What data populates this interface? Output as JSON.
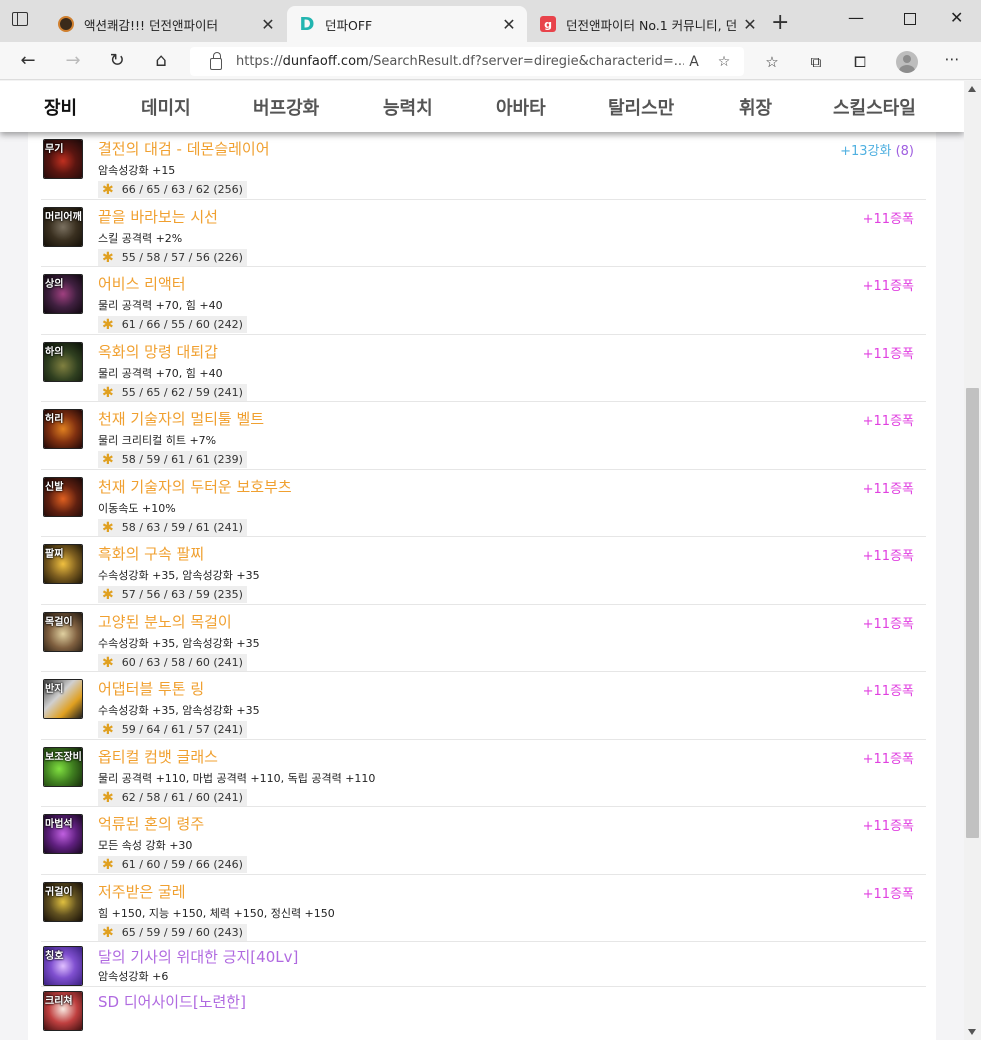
{
  "browser": {
    "tabs": [
      {
        "title": "액션쾌감!!! 던전앤파이터",
        "favicon_color": "#3a2a1a"
      },
      {
        "title": "던파OFF",
        "favicon_color": "#22b5b0"
      },
      {
        "title": "던전앤파이터 No.1 커뮤니티, 던",
        "favicon_color": "#e8434b"
      }
    ],
    "url": "https://dunfaoff.com/SearchResult.df?server=diregie&characterid=...",
    "url_host": "dunfaoff.com",
    "url_prefix": "https://",
    "url_rest": "/SearchResult.df?server=diregie&characterid=..."
  },
  "menu": {
    "items": [
      "장비",
      "데미지",
      "버프강화",
      "능력치",
      "아바타",
      "탈리스만",
      "휘장",
      "스킬스타일"
    ],
    "active": "장비"
  },
  "equipment": [
    {
      "slot": "무기",
      "name": "결전의 대검 - 데몬슬레이어",
      "stat": "암속성강화 +15",
      "badge": "66 / 65 / 63 / 62 (256)",
      "enhance": "+13강화",
      "enhance_extra": "(8)",
      "enhance_type": "reinforce"
    },
    {
      "slot": "머리어깨",
      "name": "끝을 바라보는 시선",
      "stat": "스킬 공격력 +2%",
      "badge": "55 / 58 / 57 / 56 (226)",
      "enhance": "+11증폭",
      "enhance_type": "amplify"
    },
    {
      "slot": "상의",
      "name": "어비스 리액터",
      "stat": "물리 공격력 +70, 힘 +40",
      "badge": "61 / 66 / 55 / 60 (242)",
      "enhance": "+11증폭",
      "enhance_type": "amplify"
    },
    {
      "slot": "하의",
      "name": "옥화의 망령 대퇴갑",
      "stat": "물리 공격력 +70, 힘 +40",
      "badge": "55 / 65 / 62 / 59 (241)",
      "enhance": "+11증폭",
      "enhance_type": "amplify"
    },
    {
      "slot": "허리",
      "name": "천재 기술자의 멀티툴 벨트",
      "stat": "물리 크리티컬 히트 +7%",
      "badge": "58 / 59 / 61 / 61 (239)",
      "enhance": "+11증폭",
      "enhance_type": "amplify"
    },
    {
      "slot": "신발",
      "name": "천재 기술자의 두터운 보호부츠",
      "stat": "이동속도 +10%",
      "badge": "58 / 63 / 59 / 61 (241)",
      "enhance": "+11증폭",
      "enhance_type": "amplify"
    },
    {
      "slot": "팔찌",
      "name": "흑화의 구속 팔찌",
      "stat": "수속성강화 +35, 암속성강화 +35",
      "badge": "57 / 56 / 63 / 59 (235)",
      "enhance": "+11증폭",
      "enhance_type": "amplify"
    },
    {
      "slot": "목걸이",
      "name": "고양된 분노의 목걸이",
      "stat": "수속성강화 +35, 암속성강화 +35",
      "badge": "60 / 63 / 58 / 60 (241)",
      "enhance": "+11증폭",
      "enhance_type": "amplify"
    },
    {
      "slot": "반지",
      "name": "어댑터블 투톤 링",
      "stat": "수속성강화 +35, 암속성강화 +35",
      "badge": "59 / 64 / 61 / 57 (241)",
      "enhance": "+11증폭",
      "enhance_type": "amplify"
    },
    {
      "slot": "보조장비",
      "name": "옵티컬 컴뱃 글래스",
      "stat": "물리 공격력 +110, 마법 공격력 +110, 독립 공격력 +110",
      "badge": "62 / 58 / 61 / 60 (241)",
      "enhance": "+11증폭",
      "enhance_type": "amplify"
    },
    {
      "slot": "마법석",
      "name": "억류된 혼의 령주",
      "stat": "모든 속성 강화 +30",
      "badge": "61 / 60 / 59 / 66 (246)",
      "enhance": "+11증폭",
      "enhance_type": "amplify"
    },
    {
      "slot": "귀걸이",
      "name": "저주받은 굴레",
      "stat": "힘 +150, 지능 +150, 체력 +150, 정신력 +150",
      "badge": "65 / 59 / 59 / 60 (243)",
      "enhance": "+11증폭",
      "enhance_type": "amplify"
    },
    {
      "slot": "칭호",
      "name": "달의 기사의 위대한 긍지[40Lv]",
      "stat": "암속성강화 +6",
      "badge": "",
      "enhance": "",
      "enhance_type": "none"
    },
    {
      "slot": "크리쳐",
      "name": "SD 디어사이드[노련한]",
      "stat": "",
      "badge": "",
      "enhance": "",
      "enhance_type": "none"
    }
  ],
  "colors": {
    "item_name": "#f0a030",
    "item_name_special": "#b06ae0",
    "amplify": "#e040e0",
    "reinforce": "#50b0e0"
  }
}
